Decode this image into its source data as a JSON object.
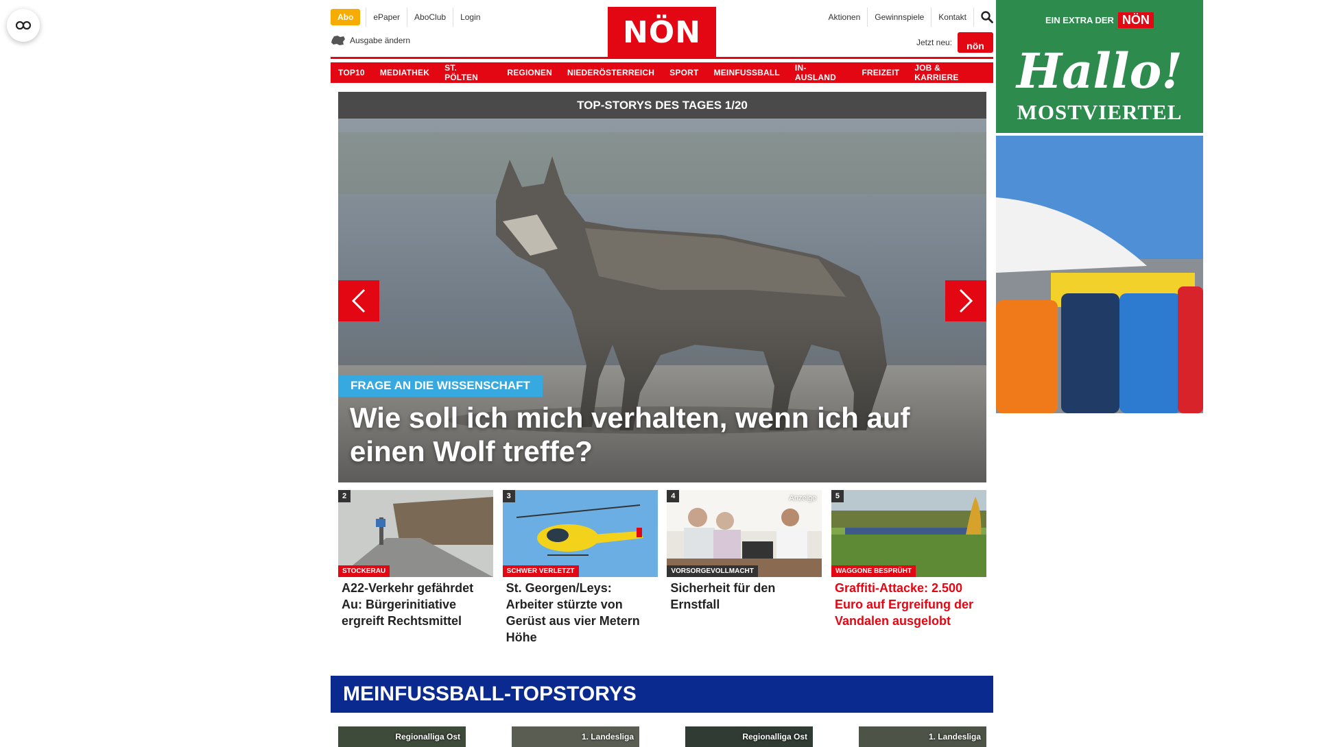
{
  "header": {
    "abo_label": "Abo",
    "links_left": [
      "ePaper",
      "AboClub",
      "Login"
    ],
    "ausgabe_label": "Ausgabe ändern",
    "logo_text": "NÖN",
    "links_right": [
      "Aktionen",
      "Gewinnspiele",
      "Kontakt"
    ],
    "jetzt_label": "Jetzt neu:",
    "jetzt_badge": "nön"
  },
  "nav": [
    "TOP10",
    "MEDIATHEK",
    "ST. PÖLTEN",
    "REGIONEN",
    "NIEDERÖSTERREICH",
    "SPORT",
    "MEINFUSSBALL",
    "IN-AUSLAND",
    "FREIZEIT",
    "JOB & KARRIERE"
  ],
  "hero": {
    "header": "TOP-STORYS DES TAGES 1/20",
    "category": "FRAGE AN DIE WISSENSCHAFT",
    "title": "Wie soll ich mich verhalten, wenn ich auf einen Wolf treffe?"
  },
  "cards": [
    {
      "num": "2",
      "category": "STOCKERAU",
      "title": "A22-Verkehr gefährdet Au: Bürgerinitiative ergreift Rechtsmittel"
    },
    {
      "num": "3",
      "category": "SCHWER VERLETZT",
      "title": "St. Georgen/Leys: Arbeiter stürzte von Gerüst aus vier Metern Höhe"
    },
    {
      "num": "4",
      "category": "VORSORGEVOLLMACHT",
      "title": "Sicherheit für den Ernstfall",
      "anzeige": "Anzeige"
    },
    {
      "num": "5",
      "category": "WAGGONE BESPRÜHT",
      "title": "Graffiti-Attacke: 2.500 Euro auf Ergreifung der Vandalen ausgelobt"
    }
  ],
  "section": {
    "title": "MEINFUSSBALL-TOPSTORYS",
    "items": [
      "Regionalliga Ost",
      "1. Landesliga",
      "Regionalliga Ost",
      "1. Landesliga"
    ]
  },
  "ad": {
    "extra": "EIN EXTRA DER",
    "logo": "NÖN",
    "hallo": "Hallo!",
    "region": "MOSTVIERTEL"
  }
}
